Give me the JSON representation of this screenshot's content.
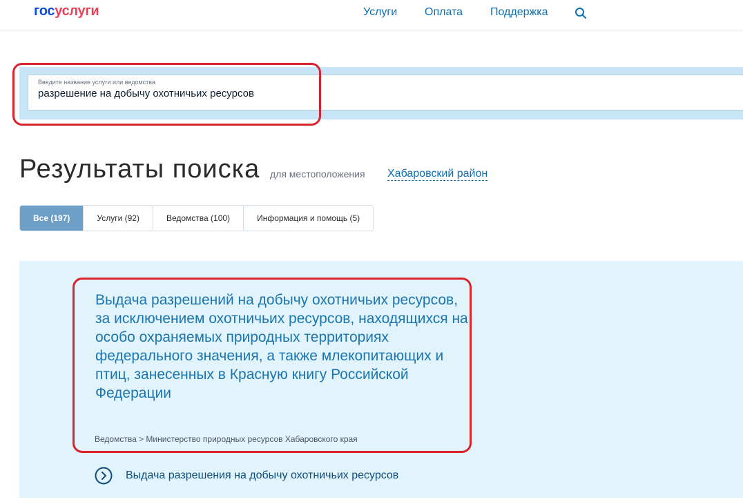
{
  "header": {
    "logo_part1": "гос",
    "logo_part2": "услуги",
    "nav": {
      "services": "Услуги",
      "payment": "Оплата",
      "support": "Поддержка"
    },
    "search_icon": "search-icon"
  },
  "search": {
    "label": "Введите название услуги или ведомства",
    "value": "разрешение на добычу охотничьих ресурсов"
  },
  "results": {
    "title": "Результаты поиска",
    "for_location": "для местоположения",
    "location": "Хабаровский район"
  },
  "tabs": [
    {
      "label": "Все (197)",
      "active": true
    },
    {
      "label": "Услуги (92)",
      "active": false
    },
    {
      "label": "Ведомства (100)",
      "active": false
    },
    {
      "label": "Информация и помощь (5)",
      "active": false
    }
  ],
  "result": {
    "title": "Выдача разрешений на добычу охотничьих ресурсов, за исключением охотничьих ресурсов, находящихся на особо охраняемых природных территориях федерального значения, а также млекопитающих и птиц, занесенных в Красную книгу Российской Федерации",
    "breadcrumb": "Ведомства > Министерство природных ресурсов Хабаровского края",
    "sub_link": "Выдача разрешения на добычу охотничьих ресурсов",
    "sub_link_icon": "chevron-right-circle-icon"
  },
  "colors": {
    "accent": "#0d6eb3",
    "highlight": "#d9222e",
    "active_tab": "#6d9fc7",
    "search_band": "#c8e4f7",
    "result_panel": "#e1f3fb"
  }
}
